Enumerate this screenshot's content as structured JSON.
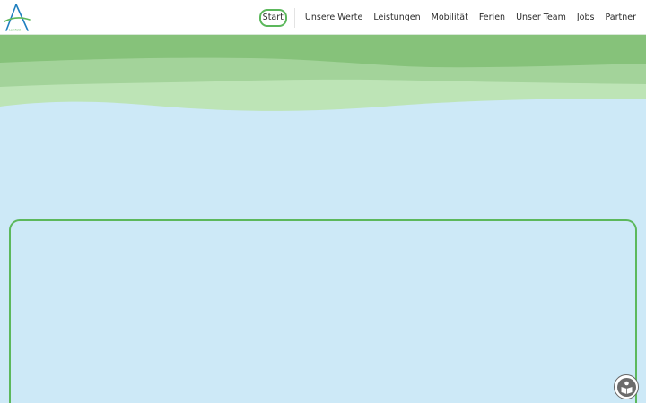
{
  "logo": {
    "text": "Lernfeld",
    "icon": "letter-a-logo"
  },
  "nav": {
    "items": [
      {
        "label": "Start",
        "active": true
      },
      {
        "label": "Unsere Werte"
      },
      {
        "label": "Leistungen"
      },
      {
        "label": "Mobilität"
      },
      {
        "label": "Ferien"
      },
      {
        "label": "Unser Team"
      },
      {
        "label": "Jobs"
      },
      {
        "label": "Partner"
      }
    ]
  },
  "colors": {
    "accent": "#5cb85c",
    "wave_dark": "#86c27a",
    "wave_mid": "#a3d39a",
    "wave_light": "#bde4b6",
    "background": "#cde9f7"
  },
  "accessibility": {
    "icon": "accessibility-reader-icon"
  }
}
